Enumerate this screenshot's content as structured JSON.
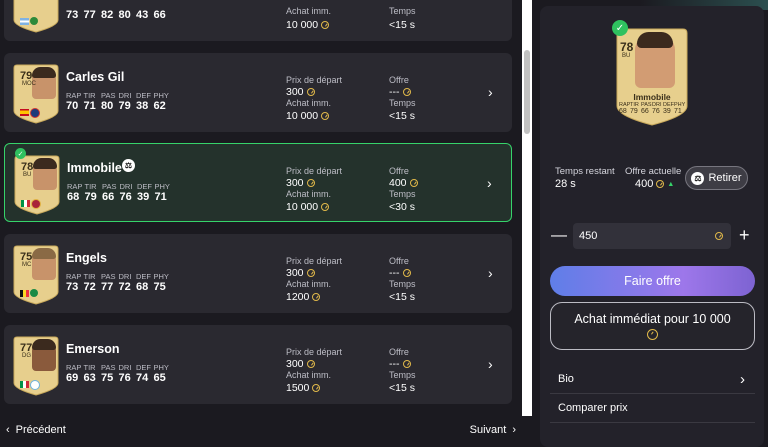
{
  "colors": {
    "accent_green": "#36d36a",
    "coin": "#e1b94a",
    "card_gold": "#e7cf8d"
  },
  "stat_headers": [
    "RAP",
    "TIR",
    "PAS",
    "DRI",
    "DEF",
    "PHY"
  ],
  "labels": {
    "start_price": "Prix de départ",
    "offer": "Offre",
    "buy_now": "Achat imm.",
    "time": "Temps"
  },
  "rows": [
    {
      "name": "",
      "rating": "",
      "position": "",
      "stats": [
        "73",
        "77",
        "82",
        "80",
        "43",
        "66"
      ],
      "start_price": "",
      "offer": "",
      "buy_now": "10 000",
      "time": "<15 s"
    },
    {
      "name": "Carles Gil",
      "rating": "79",
      "position": "MOC",
      "stats": [
        "70",
        "71",
        "80",
        "79",
        "38",
        "62"
      ],
      "start_price": "300",
      "offer": "---",
      "buy_now": "10 000",
      "time": "<15 s"
    },
    {
      "name": "Immobile",
      "rating": "78",
      "position": "BU",
      "stats": [
        "68",
        "79",
        "66",
        "76",
        "39",
        "71"
      ],
      "start_price": "300",
      "offer": "400",
      "buy_now": "10 000",
      "time": "<30 s",
      "selected": true
    },
    {
      "name": "Engels",
      "rating": "75",
      "position": "MC",
      "stats": [
        "73",
        "72",
        "77",
        "72",
        "68",
        "75"
      ],
      "start_price": "300",
      "offer": "---",
      "buy_now": "1200",
      "time": "<15 s"
    },
    {
      "name": "Emerson",
      "rating": "77",
      "position": "DG",
      "stats": [
        "69",
        "63",
        "75",
        "76",
        "74",
        "65"
      ],
      "start_price": "300",
      "offer": "---",
      "buy_now": "1500",
      "time": "<15 s"
    }
  ],
  "pager": {
    "prev": "Précédent",
    "next": "Suivant"
  },
  "detail": {
    "card": {
      "rating": "78",
      "position": "BU",
      "name": "Immobile",
      "stats": [
        "68",
        "79",
        "66",
        "76",
        "39",
        "71"
      ]
    },
    "time_left_label": "Temps restant",
    "time_left": "28 s",
    "current_offer_label": "Offre actuelle",
    "current_offer": "400",
    "retire_label": "Retirer",
    "bid_value": "450",
    "offer_button": "Faire offre",
    "buy_now_button": "Achat immédiat pour 10 000",
    "menu": [
      "Bio",
      "Comparer prix"
    ]
  }
}
